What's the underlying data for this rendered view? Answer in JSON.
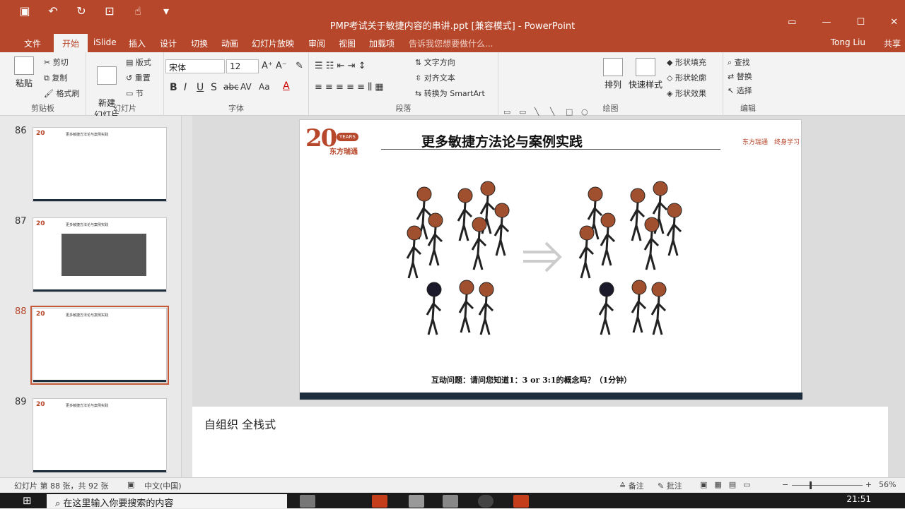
{
  "window": {
    "title": "PMP考试关于敏捷内容的串讲.ppt [兼容模式] - PowerPoint"
  },
  "tabs": [
    "文件",
    "开始",
    "iSlide",
    "插入",
    "设计",
    "切换",
    "动画",
    "幻灯片放映",
    "审阅",
    "视图",
    "加载项"
  ],
  "tell_me": "告诉我您想要做什么...",
  "user": "Tong Liu",
  "share": "共享",
  "ribbon": {
    "clipboard": {
      "label": "剪贴板",
      "paste": "粘贴",
      "cut": "剪切",
      "copy": "复制",
      "format_painter": "格式刷"
    },
    "slides": {
      "label": "幻灯片",
      "new_slide": "新建\n幻灯片",
      "layout": "版式",
      "reset": "重置",
      "section": "节"
    },
    "font": {
      "label": "字体",
      "name": "宋体",
      "size": "12"
    },
    "paragraph": {
      "label": "段落",
      "text_direction": "文字方向",
      "align_text": "对齐文本",
      "smartart": "转换为 SmartArt"
    },
    "drawing": {
      "label": "绘图",
      "arrange": "排列",
      "quick_styles": "快速样式",
      "fill": "形状填充",
      "outline": "形状轮廓",
      "effects": "形状效果"
    },
    "editing": {
      "label": "编辑",
      "find": "查找",
      "replace": "替换",
      "select": "选择"
    }
  },
  "thumbnails": [
    {
      "num": "86",
      "title": "更多敏捷方法论与案例实践"
    },
    {
      "num": "87",
      "title": "更多敏捷方法论与案例实践"
    },
    {
      "num": "88",
      "title": "更多敏捷方法论与案例实践"
    },
    {
      "num": "89",
      "title": "更多敏捷方法论与案例实践"
    }
  ],
  "slide": {
    "title": "更多敏捷方法论与案例实践",
    "right_tag": "东方瑞通　终身学习",
    "logo_num": "20",
    "logo_years": "YEARS",
    "logo_cn": "东方瑞通",
    "question": "互动问题：请问您知道1：3 or 3:1的概念吗？（1分钟）"
  },
  "notes": "自组织 全栈式",
  "status": {
    "slide_info": "幻灯片 第 88 张，共 92 张",
    "language": "中文(中国)",
    "notes_btn": "备注",
    "comments_btn": "批注",
    "zoom": "56%"
  },
  "taskbar": {
    "search_placeholder": "在这里输入你要搜索的内容",
    "time": "21:51"
  }
}
